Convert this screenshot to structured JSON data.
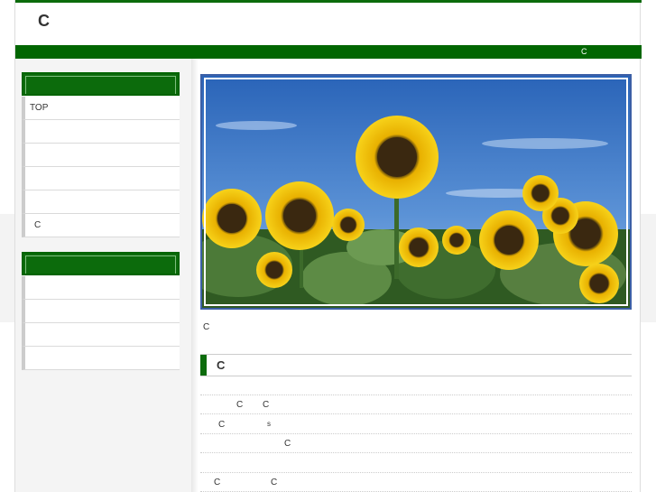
{
  "header": {
    "site_title": "C"
  },
  "nav": {
    "text": "C"
  },
  "sidebar": {
    "menu1": {
      "header": "",
      "items": [
        "TOP",
        "",
        "",
        "",
        "",
        "C"
      ]
    },
    "menu2": {
      "header": "",
      "items": [
        "",
        "",
        "",
        ""
      ]
    }
  },
  "main": {
    "hero_alt": "sunflowers",
    "intro": "C",
    "section_title": "C",
    "news": [
      {
        "a": "",
        "b": "C",
        "c": "C"
      },
      {
        "a": "C",
        "b": "s",
        "c": ""
      },
      {
        "a": "",
        "b": "C",
        "c": ""
      },
      {
        "a": "",
        "b": "",
        "c": ""
      },
      {
        "a": "C",
        "b": "C",
        "c": ""
      }
    ]
  },
  "colors": {
    "brand_green": "#016601",
    "sky": "#3a75c4",
    "petal": "#f5c400"
  }
}
